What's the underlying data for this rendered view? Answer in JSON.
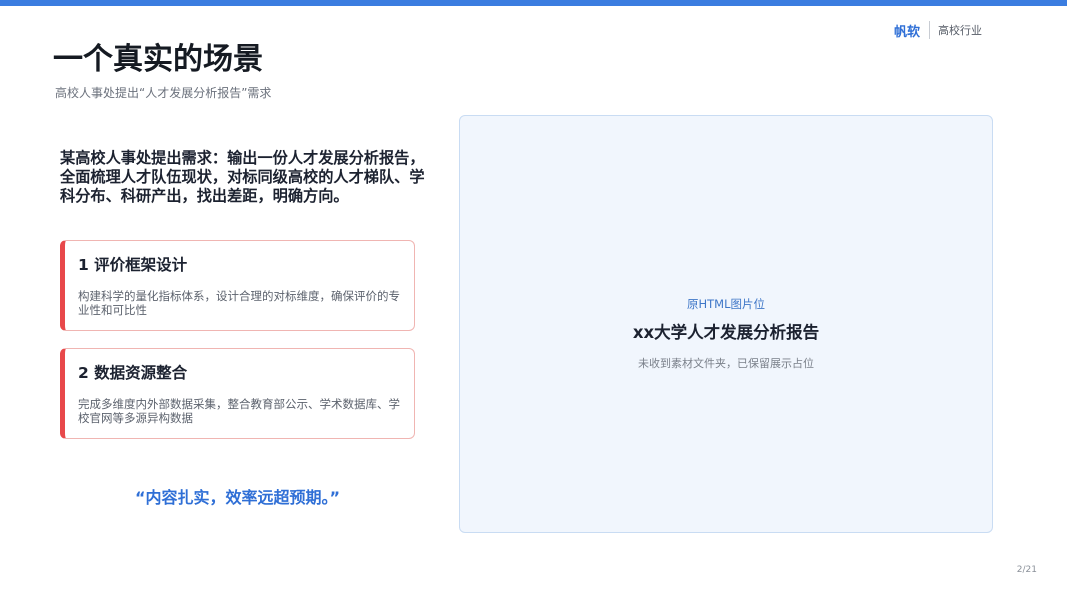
{
  "brand": {
    "name": "帆软",
    "industry": "高校行业"
  },
  "header": {
    "title": "一个真实的场景",
    "subtitle": "高校人事处提出“人才发展分析报告”需求"
  },
  "intro": "某高校人事处提出需求：输出一份人才发展分析报告，全面梳理人才队伍现状，对标同级高校的人才梯队、学科分布、科研产出，找出差距，明确方向。",
  "cards": [
    {
      "title": "1 评价框架设计",
      "text": "构建科学的量化指标体系，设计合理的对标维度，确保评价的专业性和可比性"
    },
    {
      "title": "2 数据资源整合",
      "text": "完成多维度内外部数据采集，整合教育部公示、学术数据库、学校官网等多源异构数据"
    }
  ],
  "quote": "“内容扎实，效率远超预期。”",
  "placeholder": {
    "label": "原HTML图片位",
    "title": "xx大学人才发展分析报告",
    "note": "未收到素材文件夹，已保留展示占位"
  },
  "page_number": "2/21",
  "colors": {
    "accent": "#3b7de0",
    "card_accent": "#e8484a",
    "quote": "#2f6fd6"
  }
}
